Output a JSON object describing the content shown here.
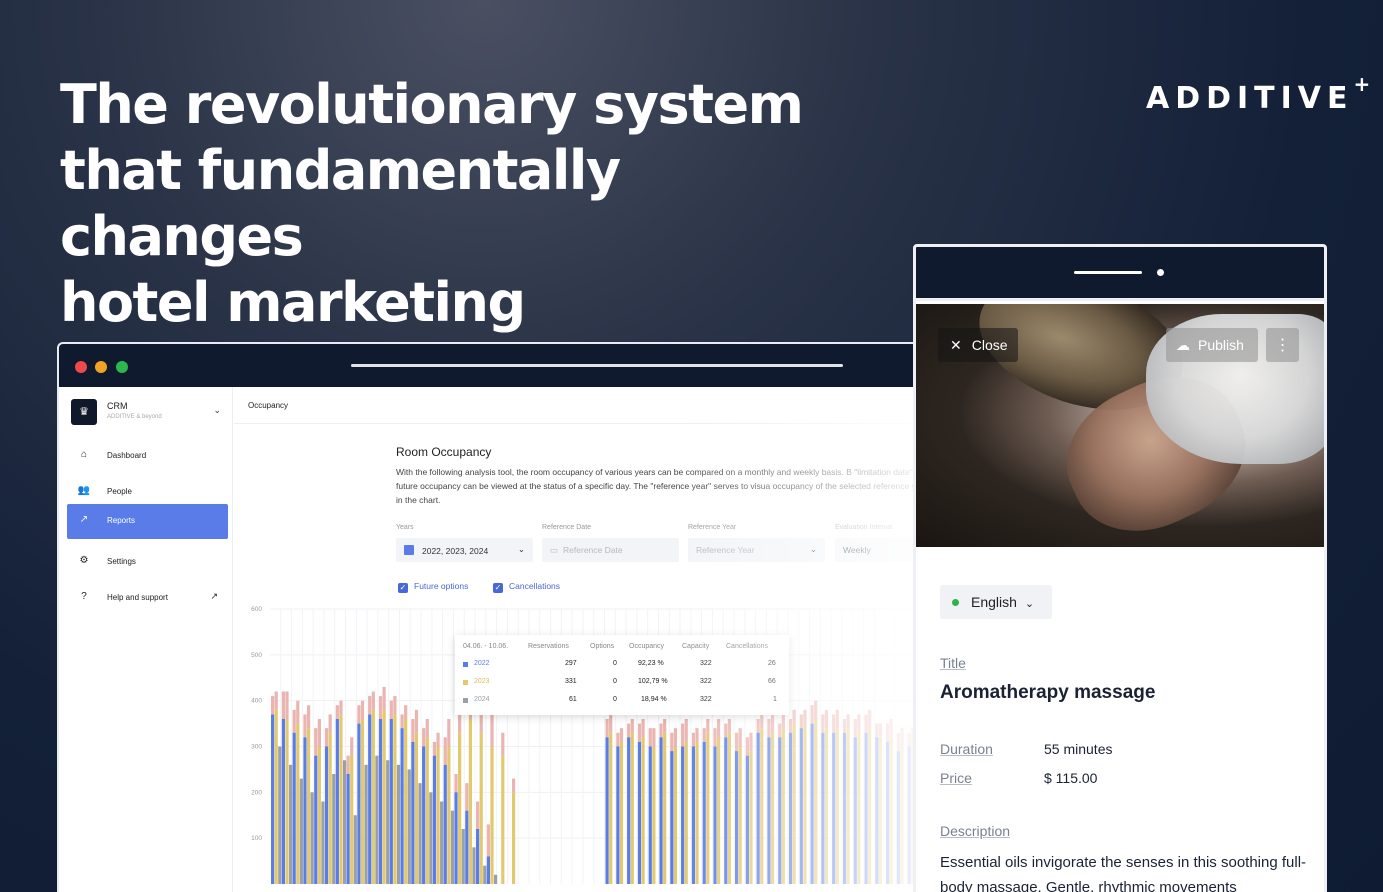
{
  "headline": {
    "line1": "The revolutionary system",
    "line2": "that fundamentally changes",
    "line3": "hotel marketing"
  },
  "brand": {
    "name": "ADDITIVE",
    "mark": "+"
  },
  "crm": {
    "sidebar": {
      "app_name": "CRM",
      "app_sub": "ADDITIVE & beyond",
      "items": [
        {
          "label": "Dashboard",
          "icon": "home-icon"
        },
        {
          "label": "People",
          "icon": "people-icon"
        },
        {
          "label": "Reports",
          "icon": "trend-icon"
        },
        {
          "label": "Settings",
          "icon": "gear-icon"
        },
        {
          "label": "Help and support",
          "icon": "help-icon"
        }
      ]
    },
    "breadcrumb": "Occupancy",
    "title": "Room Occupancy",
    "description": "With the following analysis tool, the room occupancy of various years can be compared on a monthly and weekly basis. B \"limitation date\", the future occupancy can be viewed at the status of a specific day. The \"reference year\" serves to visua occupancy of the selected reference year in the chart.",
    "filters": {
      "years": {
        "label": "Years",
        "value": "2022, 2023, 2024"
      },
      "reference_date": {
        "label": "Reference Date",
        "placeholder": "Reference Date"
      },
      "reference_year": {
        "label": "Reference Year",
        "placeholder": "Reference Year"
      },
      "interval": {
        "label": "Evaluation Interval",
        "value": "Weekly"
      }
    },
    "checkboxes": {
      "future_options": "Future options",
      "cancellations": "Cancellations"
    },
    "tooltip": {
      "headers": [
        "04.06. - 10.06.",
        "Reservations",
        "Options",
        "Occupancy",
        "Capacity",
        "Cancellations"
      ],
      "rows": [
        {
          "year": "2022",
          "color": "#5a7ce8",
          "reservations": "297",
          "options": "0",
          "occupancy": "92,23 %",
          "capacity": "322",
          "cancellations": "26"
        },
        {
          "year": "2023",
          "color": "#e3c96d",
          "reservations": "331",
          "options": "0",
          "occupancy": "102,79 %",
          "capacity": "322",
          "cancellations": "66"
        },
        {
          "year": "2024",
          "color": "#9aa0a8",
          "reservations": "61",
          "options": "0",
          "occupancy": "18,94 %",
          "capacity": "322",
          "cancellations": "1"
        }
      ]
    },
    "chart_data": {
      "type": "bar",
      "yticks": [
        "600",
        "500",
        "400",
        "300",
        "200",
        "100"
      ],
      "ylim": [
        0,
        600
      ],
      "series": [
        {
          "name": "2022",
          "color": "#5a7ce8",
          "values": [
            370,
            360,
            330,
            320,
            280,
            300,
            360,
            240,
            350,
            370,
            360,
            360,
            340,
            310,
            300,
            280,
            260,
            200,
            160,
            120,
            60,
            0,
            0,
            0,
            0,
            0,
            0,
            0,
            0,
            0,
            0,
            320,
            300,
            320,
            310,
            300,
            320,
            290,
            300,
            300,
            310,
            300,
            320,
            290,
            280,
            330,
            320,
            320,
            330,
            340,
            350,
            330,
            330,
            330,
            320,
            330,
            320,
            310,
            290,
            300,
            300,
            310
          ]
        },
        {
          "name": "2023",
          "color": "#e3c96d",
          "values": [
            380,
            360,
            350,
            340,
            300,
            330,
            370,
            280,
            360,
            380,
            380,
            370,
            360,
            330,
            320,
            300,
            300,
            330,
            360,
            330,
            300,
            280,
            200,
            0,
            0,
            0,
            0,
            0,
            0,
            0,
            0,
            330,
            310,
            330,
            320,
            300,
            330,
            300,
            310,
            310,
            330,
            320,
            330,
            300,
            290,
            340,
            330,
            340,
            350,
            350,
            360,
            340,
            340,
            340,
            330,
            340,
            320,
            320,
            300,
            310,
            310,
            320
          ]
        },
        {
          "name": "2024",
          "color": "#9aa0a8",
          "values": [
            300,
            260,
            230,
            200,
            180,
            240,
            270,
            150,
            260,
            280,
            270,
            260,
            250,
            220,
            200,
            180,
            160,
            120,
            80,
            40,
            20,
            0,
            0,
            0,
            0,
            0,
            0,
            0,
            0,
            0,
            0,
            0,
            0,
            0,
            0,
            0,
            0,
            0,
            0,
            0,
            0,
            0,
            0,
            0,
            0,
            0,
            0,
            0,
            0,
            0,
            0,
            0,
            0,
            0,
            0,
            0,
            0,
            0,
            0,
            0,
            0,
            0
          ]
        },
        {
          "name": "Cancellations",
          "color": "#eab4b0",
          "values": [
            40,
            60,
            50,
            50,
            60,
            40,
            30,
            40,
            40,
            40,
            50,
            40,
            30,
            50,
            40,
            30,
            60,
            40,
            60,
            60,
            70,
            50,
            30,
            0,
            0,
            0,
            0,
            0,
            0,
            0,
            0,
            40,
            30,
            30,
            40,
            40,
            30,
            40,
            50,
            30,
            30,
            40,
            30,
            40,
            40,
            30,
            40,
            30,
            30,
            30,
            40,
            40,
            40,
            30,
            40,
            40,
            30,
            40,
            40,
            30,
            30,
            30
          ]
        }
      ]
    }
  },
  "mobile": {
    "close_label": "Close",
    "publish_label": "Publish",
    "language": "English",
    "title_label": "Title",
    "title": "Aromatherapy massage",
    "duration_label": "Duration",
    "duration": "55 minutes",
    "price_label": "Price",
    "price": "$ 115.00",
    "description_label": "Description",
    "description": "Essential oils invigorate the senses in this soothing full-body massage. Gentle, rhythmic movements"
  }
}
